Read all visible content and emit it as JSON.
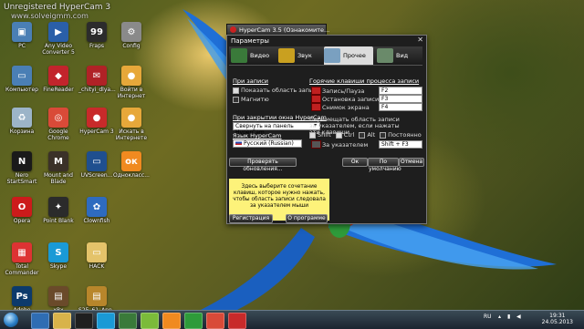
{
  "watermark": {
    "line1": "Unregistered HyperCam 3",
    "line2": "www.solveigmm.com"
  },
  "desktop_icons": [
    {
      "label": "PC",
      "color": "#4a7fb5",
      "glyph": "▣"
    },
    {
      "label": "Any Video Converter 5",
      "color": "#2a5fa8",
      "glyph": "▶"
    },
    {
      "label": "Fraps",
      "color": "#2c2c2c",
      "glyph": "99"
    },
    {
      "label": "Config",
      "color": "#8a8a8a",
      "glyph": "⚙"
    },
    {
      "label": "Компьютер",
      "color": "#4a7fb5",
      "glyph": "▭"
    },
    {
      "label": "FineReader",
      "color": "#c2242c",
      "glyph": "◆"
    },
    {
      "label": "_chityi_dlya...",
      "color": "#b02226",
      "glyph": "✉"
    },
    {
      "label": "Войти в Интернет",
      "color": "#e7a83a",
      "glyph": "●"
    },
    {
      "label": "Корзина",
      "color": "#9cb4c8",
      "glyph": "♻"
    },
    {
      "label": "Google Chrome",
      "color": "#d94a38",
      "glyph": "◎"
    },
    {
      "label": "HyperCam 3",
      "color": "#c82a2a",
      "glyph": "●"
    },
    {
      "label": "Искать в Интернете",
      "color": "#e7a83a",
      "glyph": "●"
    },
    {
      "label": "Nero StartSmart",
      "color": "#1a1a1a",
      "glyph": "N"
    },
    {
      "label": "Mount and Blade",
      "color": "#3b3128",
      "glyph": "M"
    },
    {
      "label": "UVScreen...",
      "color": "#1f4f8f",
      "glyph": "▭"
    },
    {
      "label": "Однокласс...",
      "color": "#f08a20",
      "glyph": "ок"
    },
    {
      "label": "Opera",
      "color": "#cc1b1b",
      "glyph": "O"
    },
    {
      "label": "Point Blank",
      "color": "#2b2b2b",
      "glyph": "✦"
    },
    {
      "label": "Clownfish",
      "color": "#2e6bbf",
      "glyph": "✿"
    },
    {
      "label": "Total Commander",
      "color": "#d33",
      "glyph": "▦"
    },
    {
      "label": "Skype",
      "color": "#1a9ad6",
      "glyph": "S"
    },
    {
      "label": "HACK",
      "color": "#e4c36a",
      "glyph": "▭"
    },
    {
      "label": "Adobe Photosho...",
      "color": "#0c3a6b",
      "glyph": "Ps"
    },
    {
      "label": "xBx",
      "color": "#6a4a2a",
      "glyph": "▤"
    },
    {
      "label": "S25_61_Ann...",
      "color": "#b8862b",
      "glyph": "▤"
    }
  ],
  "window": {
    "title": "HyperCam 3.5 (Ознакомите...",
    "dialog_title": "Параметры",
    "close": "✕"
  },
  "tabs": [
    {
      "label": "Видео",
      "color": "#3a7a3a"
    },
    {
      "label": "Звук",
      "color": "#c9a020"
    },
    {
      "label": "Прочее",
      "color": "#7aa0c0"
    },
    {
      "label": "Вид",
      "color": "#6a8a6a"
    }
  ],
  "active_tab": "Прочее",
  "while_recording": {
    "heading": "При записи",
    "opt1": "Показать область записи",
    "opt1_checked": true,
    "opt2": "Магнитю",
    "opt2_checked": false
  },
  "minimize_to": {
    "heading": "При закрытии окна HyperCam",
    "value": "Свернуть на панель HyperCam"
  },
  "language": {
    "heading": "Язык HyperCam",
    "value": "Русский (Russian)"
  },
  "check_updates": "Проверять обновления...",
  "hotkeys": {
    "heading": "Горячие клавиши процесса записи",
    "items": [
      {
        "label": "Запись/Пауза",
        "value": "F2"
      },
      {
        "label": "Остановка записи",
        "value": "F3"
      },
      {
        "label": "Снимок экрана",
        "value": "F4"
      }
    ],
    "move_heading": "Перемещать область записи за указателем, если нажаты эти клавиши",
    "mods": [
      {
        "label": "Shift",
        "checked": true
      },
      {
        "label": "Ctrl",
        "checked": true
      },
      {
        "label": "Alt",
        "checked": false
      },
      {
        "label": "Постоянно",
        "checked": false
      }
    ],
    "follow_label": "За указателем",
    "follow_value": "Shift + F3"
  },
  "help_text": "Здесь выберите сочетание клавиш, которое нужно нажать, чтобы область записи следовала за указателем мыши",
  "buttons": {
    "ok": "Ок",
    "default": "По умолчанию",
    "cancel": "Отмена",
    "register": "Регистрация",
    "about": "О программе"
  },
  "taskbar": {
    "items": [
      {
        "color": "#2f6db3"
      },
      {
        "color": "#d8b34a"
      },
      {
        "color": "#1f1f1f"
      },
      {
        "color": "#1a9ad6"
      },
      {
        "color": "#3a7a3a"
      },
      {
        "color": "#7bbb3a"
      },
      {
        "color": "#f08a20"
      },
      {
        "color": "#2e9b3a"
      },
      {
        "color": "#d94a38"
      },
      {
        "color": "#c82a2a"
      }
    ],
    "lang": "RU",
    "time": "19:31",
    "date": "24.05.2013"
  }
}
